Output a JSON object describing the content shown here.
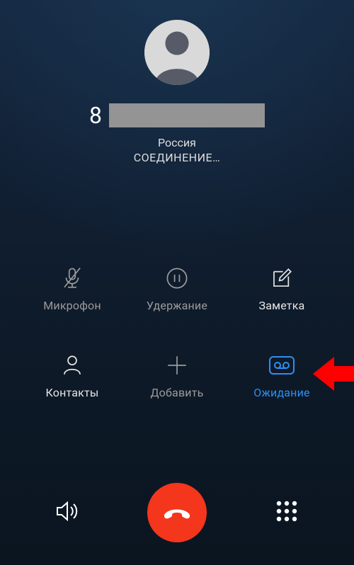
{
  "avatar": {
    "kind": "generic-person"
  },
  "number": {
    "prefix": "8",
    "redacted": true
  },
  "location": "Россия",
  "status": "СОЕДИНЕНИЕ…",
  "actions": {
    "mute": {
      "label": "Микрофон",
      "enabled": false,
      "active": false
    },
    "hold": {
      "label": "Удержание",
      "enabled": false,
      "active": false
    },
    "note": {
      "label": "Заметка",
      "enabled": true,
      "active": false
    },
    "contacts": {
      "label": "Контакты",
      "enabled": true,
      "active": false
    },
    "add": {
      "label": "Добавить",
      "enabled": false,
      "active": false
    },
    "waiting": {
      "label": "Ожидание",
      "enabled": true,
      "active": true
    }
  },
  "bottom": {
    "speaker": true,
    "end_call": true,
    "dialpad": true
  },
  "annotation": {
    "arrow_target": "waiting"
  }
}
